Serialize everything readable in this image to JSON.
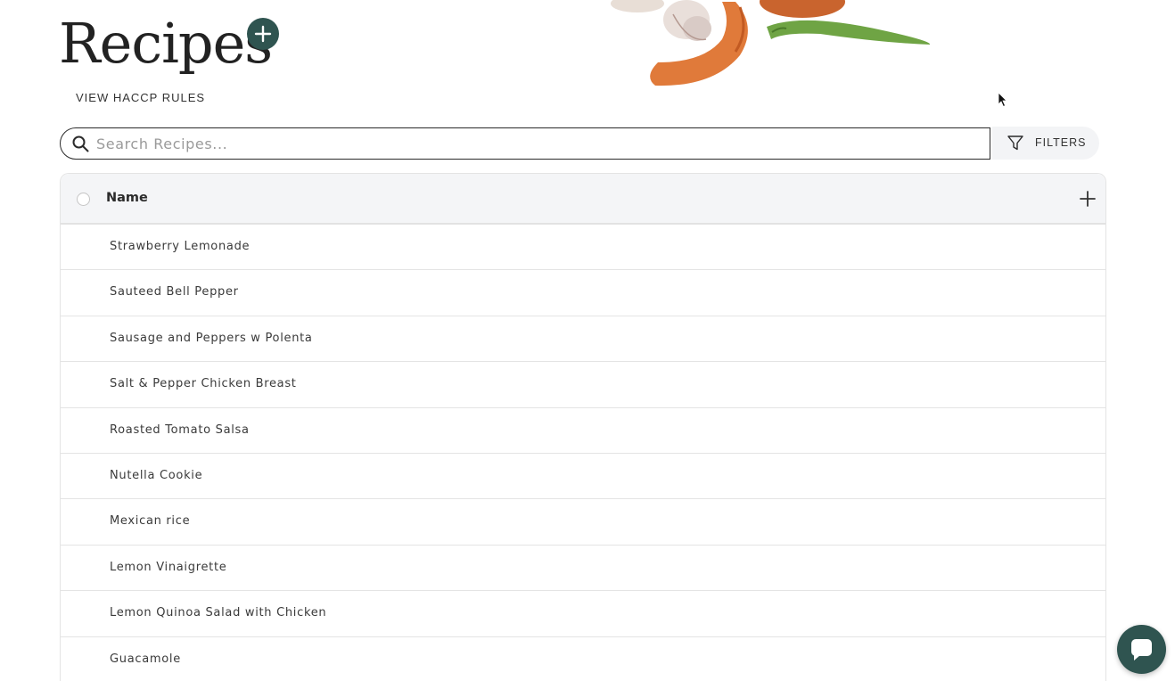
{
  "header": {
    "title": "Recipes",
    "haccp_link": "VIEW HACCP RULES"
  },
  "search": {
    "placeholder": "Search Recipes...",
    "value": ""
  },
  "filters": {
    "label": "FILTERS"
  },
  "table": {
    "column_name": "Name",
    "rows": [
      {
        "name": "Strawberry Lemonade"
      },
      {
        "name": "Sauteed Bell Pepper"
      },
      {
        "name": "Sausage and Peppers w Polenta"
      },
      {
        "name": "Salt & Pepper Chicken Breast"
      },
      {
        "name": "Roasted Tomato Salsa"
      },
      {
        "name": "Nutella Cookie"
      },
      {
        "name": "Mexican rice"
      },
      {
        "name": "Lemon Vinaigrette"
      },
      {
        "name": "Lemon Quinoa Salad with Chicken"
      },
      {
        "name": "Guacamole"
      }
    ]
  },
  "icons": {
    "add_recipe": "plus-circle-icon",
    "search": "search-icon",
    "filter": "funnel-icon",
    "add_column": "plus-icon",
    "chat": "chat-bubble-icon"
  },
  "colors": {
    "accent": "#2f5450",
    "header_bg": "#f4f5f7",
    "border": "#e4e4e4"
  }
}
